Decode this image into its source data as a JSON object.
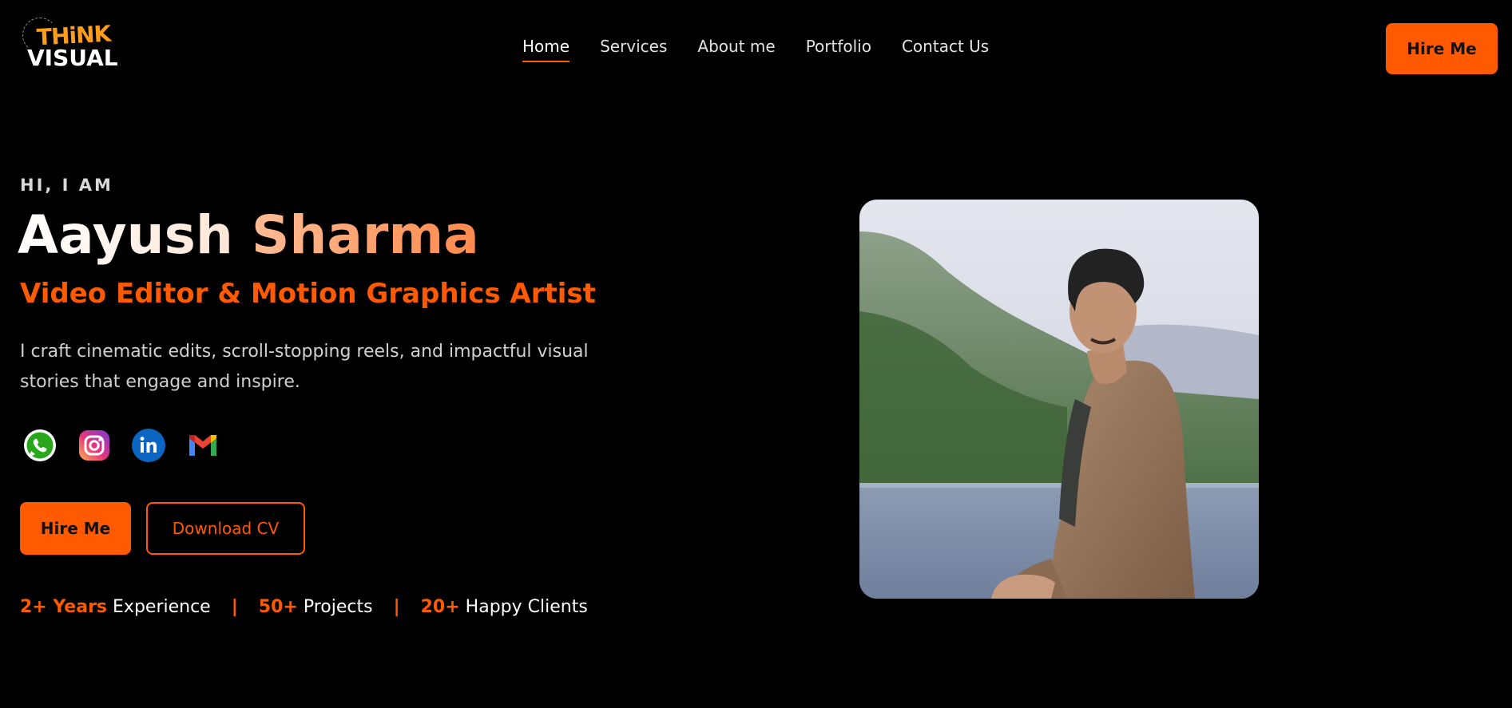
{
  "logo": {
    "line1": "THiNK",
    "line2": "VISUAL"
  },
  "nav": {
    "items": [
      {
        "label": "Home",
        "active": true
      },
      {
        "label": "Services",
        "active": false
      },
      {
        "label": "About me",
        "active": false
      },
      {
        "label": "Portfolio",
        "active": false
      },
      {
        "label": "Contact Us",
        "active": false
      }
    ],
    "cta": "Hire Me"
  },
  "hero": {
    "greeting": "HI, I AM",
    "first_name": "Aayush",
    "last_name": "Sharma",
    "role": "Video Editor & Motion Graphics Artist",
    "description": "I craft cinematic edits, scroll-stopping reels, and impactful visual stories that engage and inspire.",
    "socials": [
      {
        "name": "whatsapp-icon"
      },
      {
        "name": "instagram-icon"
      },
      {
        "name": "linkedin-icon"
      },
      {
        "name": "gmail-icon"
      }
    ],
    "primary_button": "Hire Me",
    "secondary_button": "Download CV",
    "stats": [
      {
        "value": "2+ Years",
        "label": "Experience"
      },
      {
        "value": "50+",
        "label": "Projects"
      },
      {
        "value": "20+",
        "label": "Happy Clients"
      }
    ]
  },
  "colors": {
    "accent": "#ff5a00",
    "background": "#000000"
  }
}
